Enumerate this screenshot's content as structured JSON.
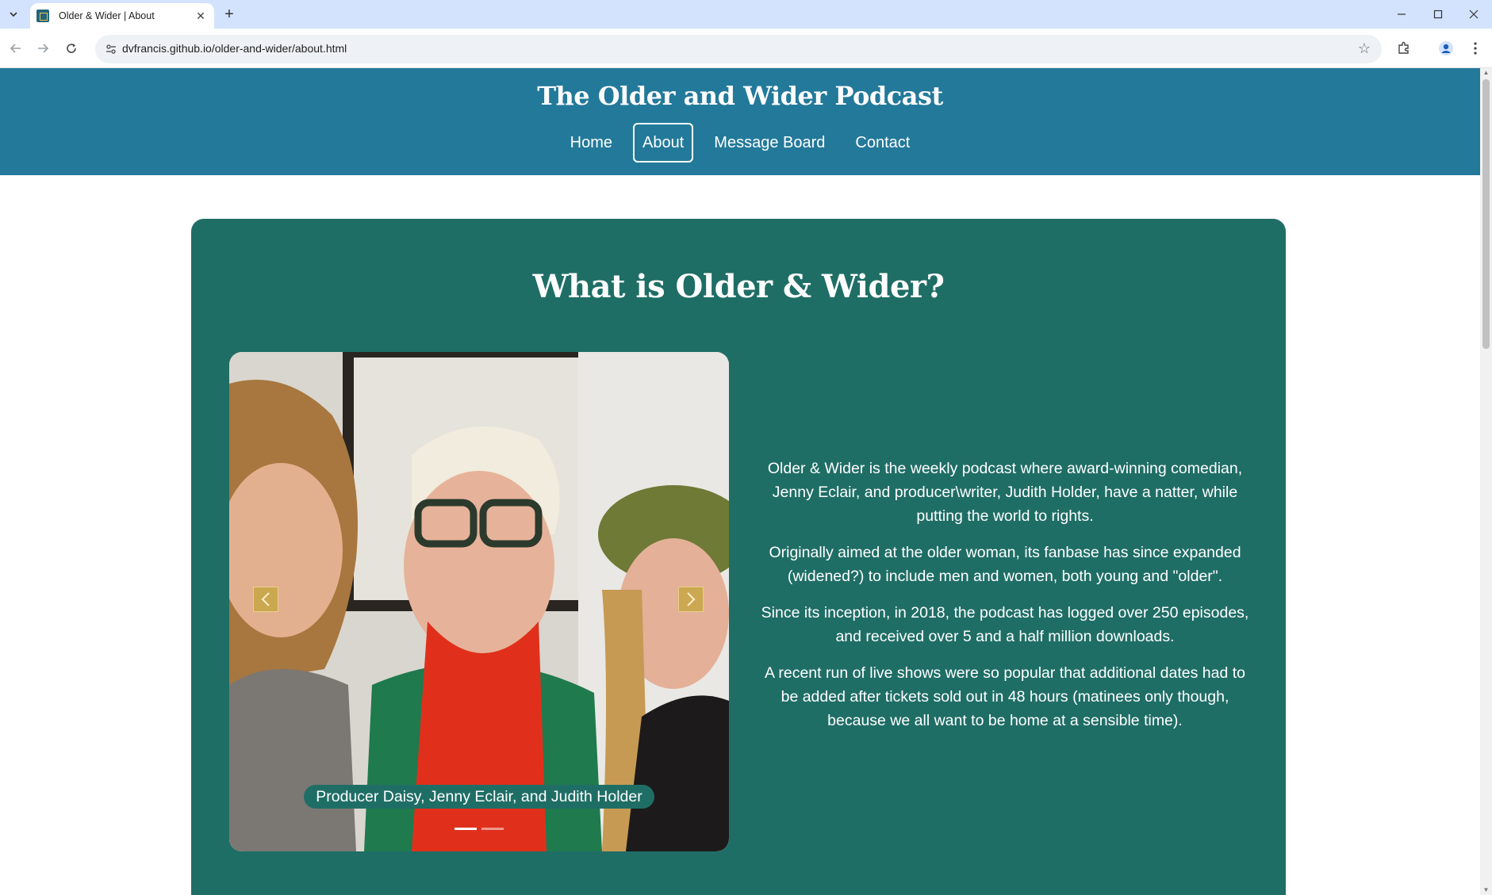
{
  "browser": {
    "tab_title": "Older & Wider | About",
    "url": "dvfrancis.github.io/older-and-wider/about.html",
    "icons": {
      "tab_list": "chevron-down-icon",
      "close_tab": "close-icon",
      "new_tab": "plus-icon",
      "back": "back-arrow-icon",
      "forward": "forward-arrow-icon",
      "reload": "reload-icon",
      "site_info": "site-settings-icon",
      "bookmark": "star-icon",
      "extensions": "puzzle-icon",
      "profile": "profile-icon",
      "menu": "kebab-menu-icon"
    }
  },
  "site": {
    "title": "The Older and Wider Podcast",
    "nav": [
      {
        "label": "Home",
        "active": false
      },
      {
        "label": "About",
        "active": true
      },
      {
        "label": "Message Board",
        "active": false
      },
      {
        "label": "Contact",
        "active": false
      }
    ]
  },
  "about": {
    "heading": "What is Older & Wider?",
    "carousel": {
      "caption": "Producer Daisy, Jenny Eclair, and Judith Holder",
      "slide_count": 2,
      "active_slide": 1
    },
    "paragraphs": [
      "Older & Wider is the weekly podcast where award-winning comedian, Jenny Eclair, and producer\\writer, Judith Holder, have a natter, while putting the world to rights.",
      "Originally aimed at the older woman, its fanbase has since expanded (widened?) to include men and women, both young and \"older\".",
      "Since its inception, in 2018, the podcast has logged over 250 episodes, and received over 5 and a half million downloads.",
      "A recent run of live shows were so popular that additional dates had to be added after tickets sold out in 48 hours (matinees only though, because we all want to be home at a sensible time)."
    ]
  },
  "colors": {
    "header_bg": "#23799a",
    "card_bg": "#1f6e66",
    "carousel_control": "#c9a84a",
    "tabbar_bg": "#d3e3fd"
  }
}
